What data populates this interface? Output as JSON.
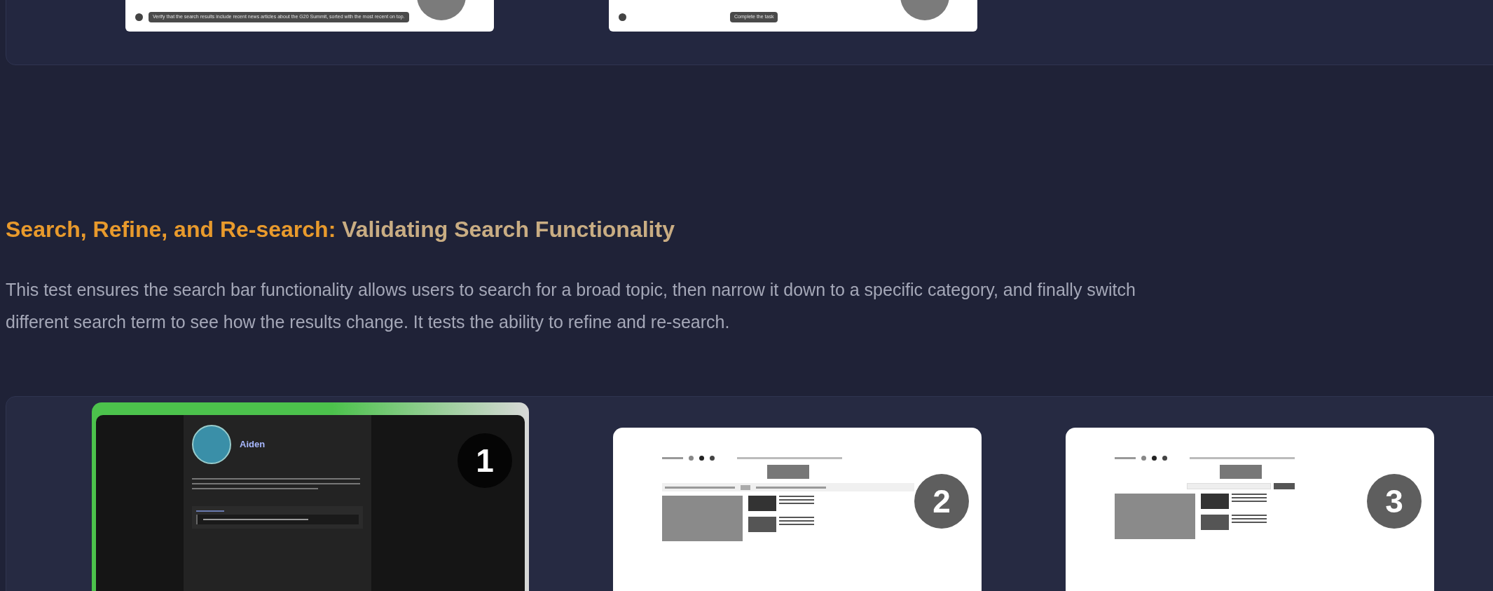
{
  "top_card": {
    "thumbnails": [
      {
        "caption": "Verify that the search results include recent news articles about the G20 Summit, sorted with the most recent on top."
      },
      {
        "caption": "Complete the task"
      }
    ]
  },
  "section": {
    "title_lead": "Search, Refine, and Re-search:",
    "title_rest": "Validating Search Functionality",
    "description_lines": [
      "This test ensures the search bar functionality allows users to search for a broad topic, then narrow it down to a specific category, and finally switch",
      "different search term to see how the results change. It tests the ability to refine and re-search."
    ]
  },
  "steps": [
    {
      "number": "1",
      "selected": true,
      "kind": "profile",
      "name": "Aiden"
    },
    {
      "number": "2",
      "selected": false,
      "kind": "page"
    },
    {
      "number": "3",
      "selected": false,
      "kind": "page_search"
    }
  ]
}
